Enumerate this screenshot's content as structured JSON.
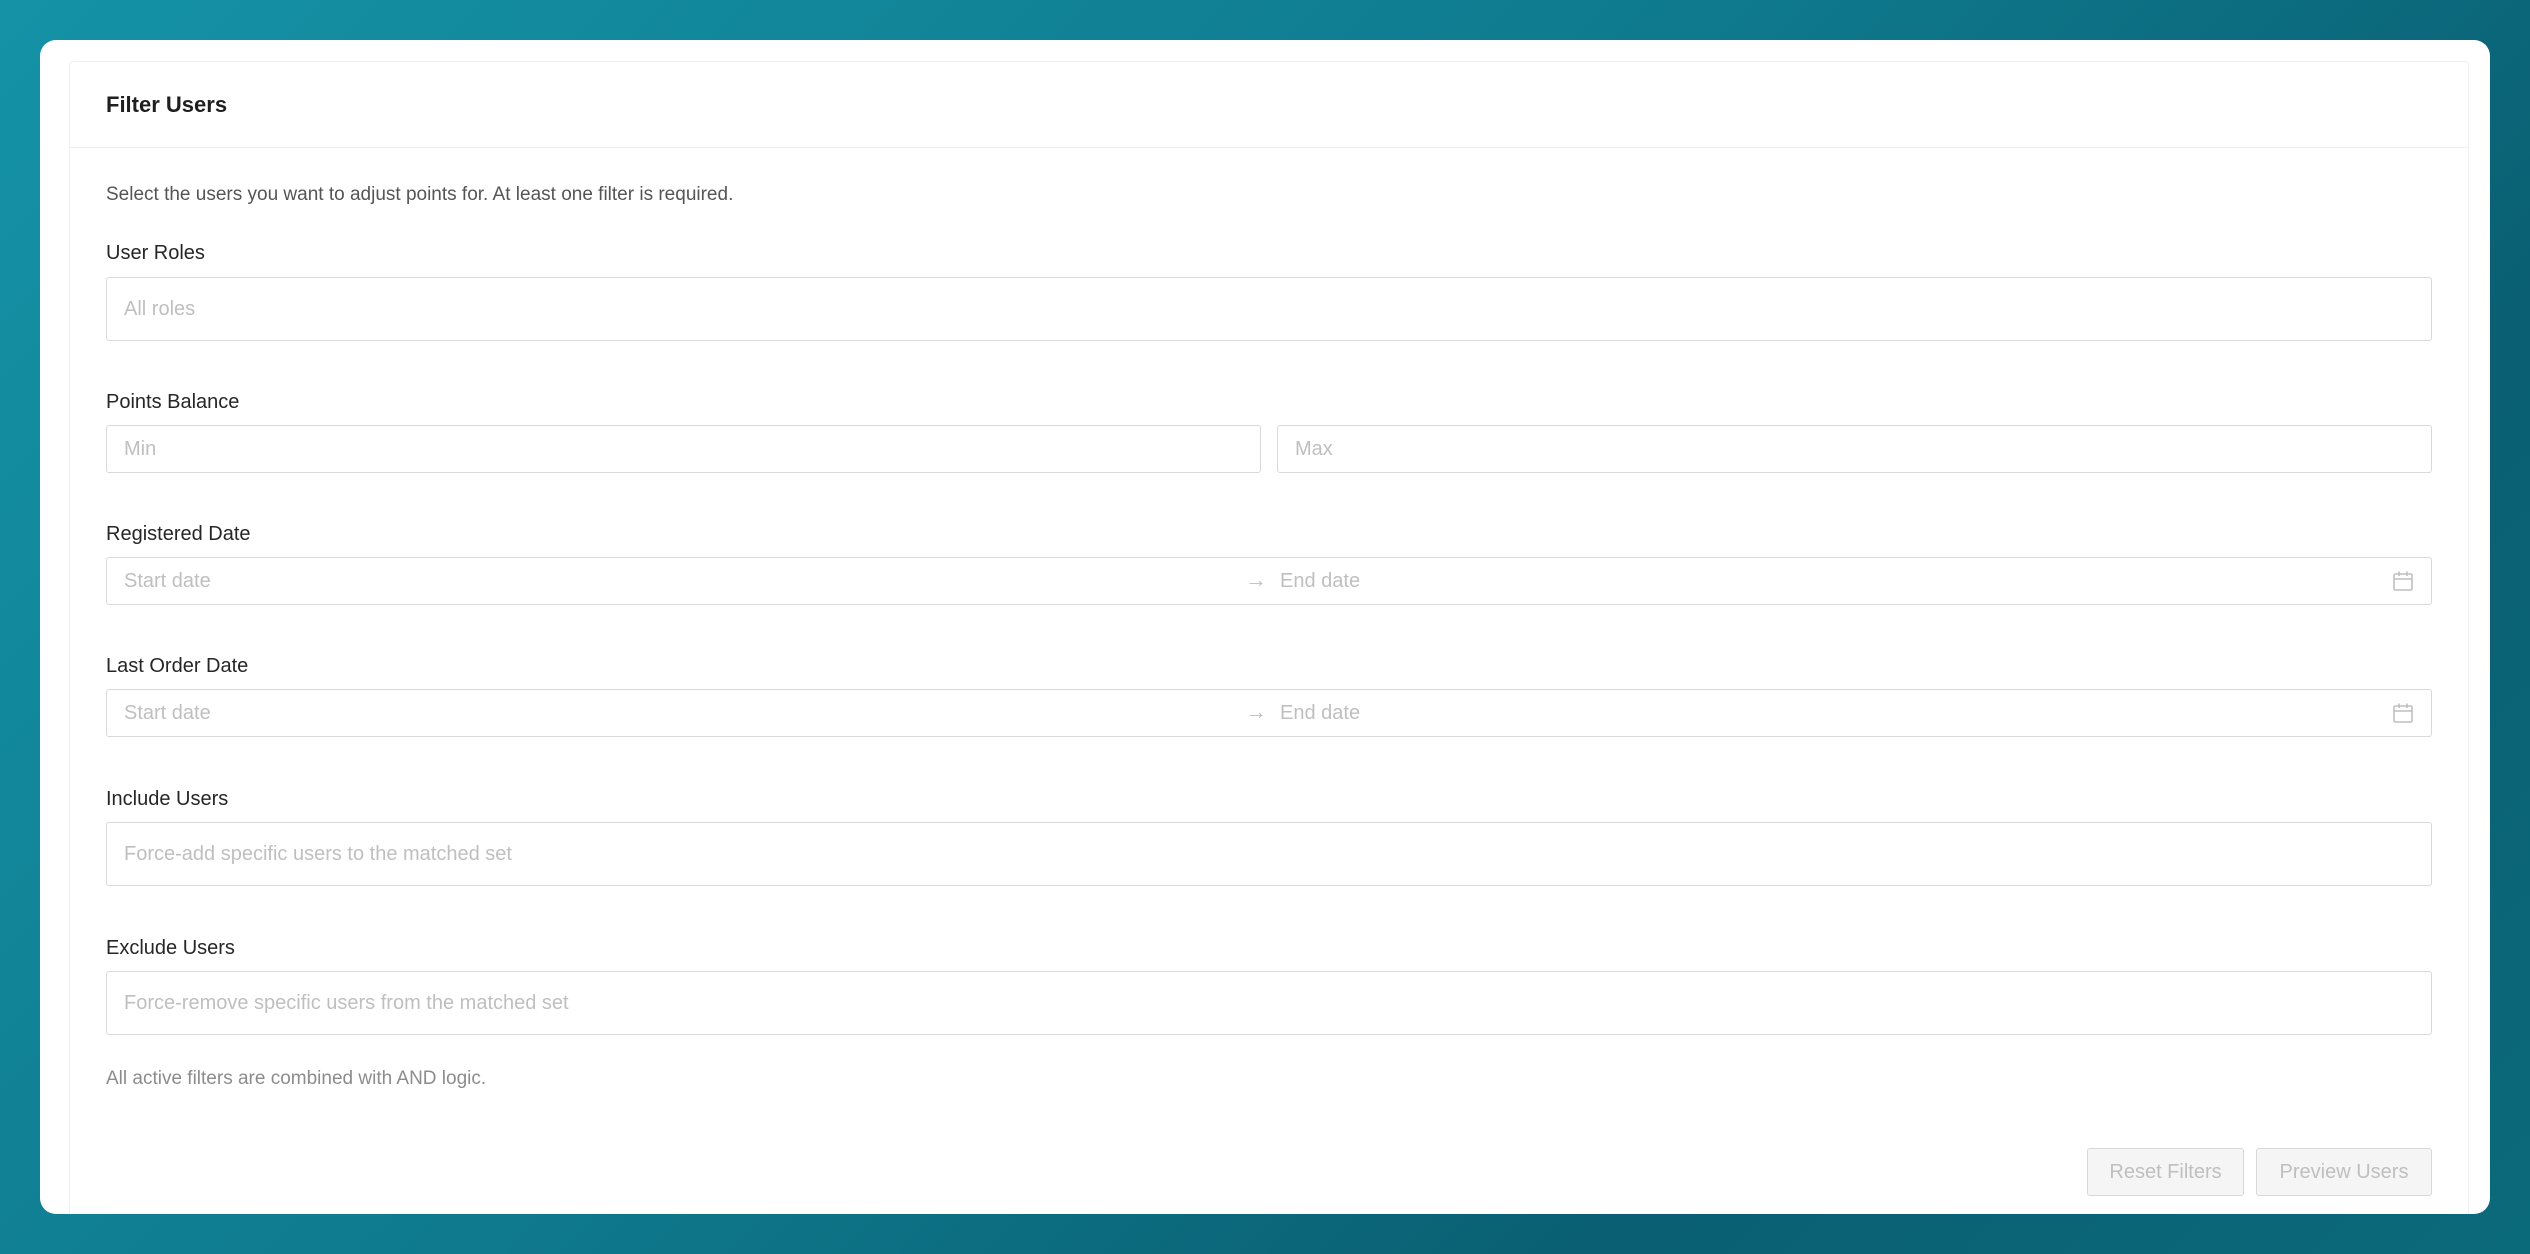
{
  "card": {
    "title": "Filter Users",
    "intro": "Select the users you want to adjust points for. At least one filter is required."
  },
  "fields": {
    "roles": {
      "label": "User Roles",
      "placeholder": "All roles"
    },
    "points": {
      "label": "Points Balance",
      "min_placeholder": "Min",
      "max_placeholder": "Max"
    },
    "registered": {
      "label": "Registered Date",
      "start_placeholder": "Start date",
      "end_placeholder": "End date",
      "separator": "→"
    },
    "last_order": {
      "label": "Last Order Date",
      "start_placeholder": "Start date",
      "end_placeholder": "End date",
      "separator": "→"
    },
    "include": {
      "label": "Include Users",
      "placeholder": "Force-add specific users to the matched set"
    },
    "exclude": {
      "label": "Exclude Users",
      "placeholder": "Force-remove specific users from the matched set"
    }
  },
  "hint": "All active filters are combined with AND logic.",
  "buttons": {
    "reset": "Reset Filters",
    "preview": "Preview Users"
  },
  "icons": {
    "calendar": "calendar-icon"
  }
}
